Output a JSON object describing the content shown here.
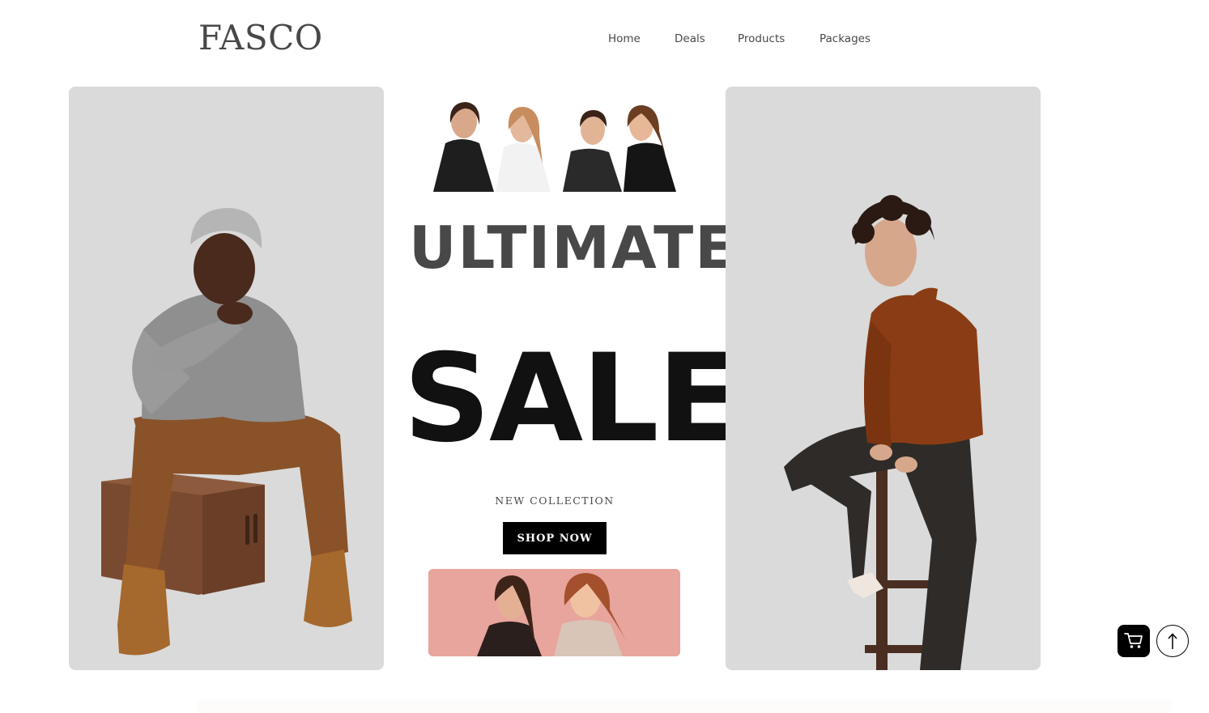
{
  "brand": {
    "logo": "FASCO"
  },
  "nav": {
    "items": [
      {
        "label": "Home"
      },
      {
        "label": "Deals"
      },
      {
        "label": "Products"
      },
      {
        "label": "Packages"
      }
    ]
  },
  "hero": {
    "headline_1": "ULTIMATE",
    "headline_2": "SALE",
    "subheading": "NEW COLLECTION",
    "cta_label": "SHOP NOW"
  },
  "floating": {
    "cart_icon": "cart-icon",
    "scroll_top_icon": "arrow-up-icon"
  },
  "colors": {
    "panel_bg": "#dadada",
    "cta_bg": "#000000",
    "headline_dark": "#111111",
    "headline_gray": "#484848",
    "promo_bg": "#e8a59d"
  }
}
